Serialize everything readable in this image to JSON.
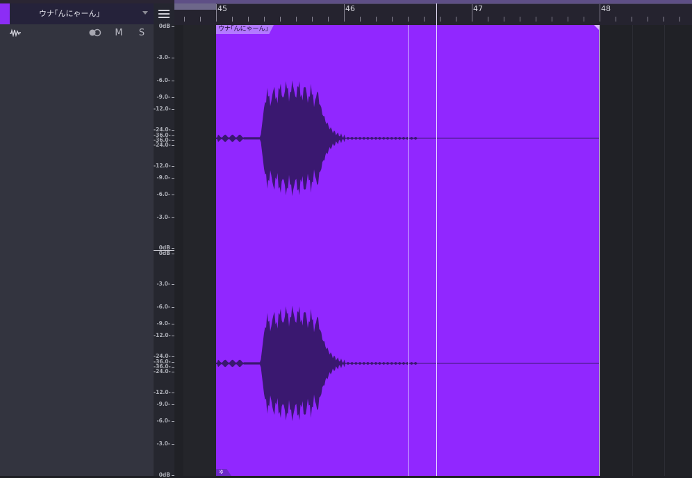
{
  "track": {
    "name": "ウナ｢んにゃーん｣",
    "color": "#8c2df5",
    "mute_label": "M",
    "solo_label": "S"
  },
  "ruler": {
    "bars": [
      "45",
      "46",
      "47",
      "48"
    ]
  },
  "db_scale": {
    "upper": [
      "0dB",
      "-3.0-",
      "-6.0-",
      "-9.0-",
      "-12.0-",
      "-24.0-",
      "-36.0-",
      "-36.0-",
      "-24.0-",
      "-12.0-",
      "-9.0-",
      "-6.0-",
      "-3.0-",
      "0dB"
    ],
    "lower": [
      "0dB",
      "-3.0-",
      "-6.0-",
      "-9.0-",
      "-12.0-",
      "-24.0-",
      "-36.0-",
      "-36.0-",
      "-24.0-",
      "-12.0-",
      "-9.0-",
      "-6.0-",
      "-3.0-",
      "0dB"
    ]
  },
  "clip": {
    "label": "ウナ｢んにゃーん｣",
    "color": "#9127ff",
    "waveform_color": "#3a1870"
  },
  "icons": {
    "waveform": "waveform-icon",
    "link": "link-icon",
    "menu": "menu-icon",
    "dropdown": "chevron-down-icon",
    "clip_settings": "gear-icon"
  }
}
